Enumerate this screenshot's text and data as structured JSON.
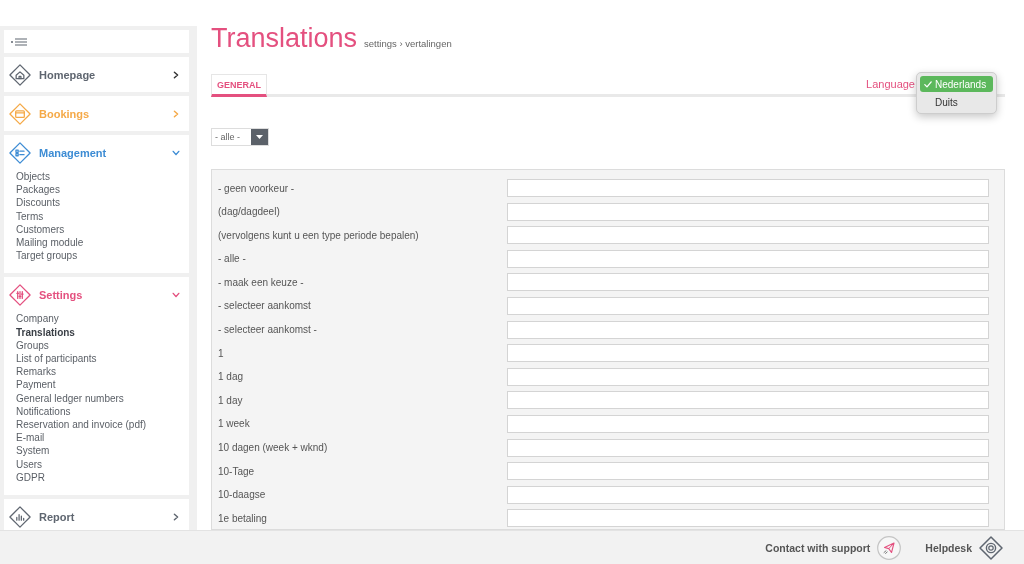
{
  "sidebar": {
    "sections": [
      {
        "label": "Homepage",
        "color": "#5f6670",
        "expanded": false
      },
      {
        "label": "Bookings",
        "color": "#f5a947",
        "expanded": false
      },
      {
        "label": "Management",
        "color": "#3d8cd4",
        "expanded": true,
        "items": [
          {
            "label": "Objects",
            "selected": false
          },
          {
            "label": "Packages",
            "selected": false
          },
          {
            "label": "Discounts",
            "selected": false
          },
          {
            "label": "Terms",
            "selected": false
          },
          {
            "label": "Customers",
            "selected": false
          },
          {
            "label": "Mailing module",
            "selected": false
          },
          {
            "label": "Target groups",
            "selected": false
          }
        ]
      },
      {
        "label": "Settings",
        "color": "#e4507f",
        "expanded": true,
        "items": [
          {
            "label": "Company",
            "selected": false
          },
          {
            "label": "Translations",
            "selected": true
          },
          {
            "label": "Groups",
            "selected": false
          },
          {
            "label": "List of participants",
            "selected": false
          },
          {
            "label": "Remarks",
            "selected": false
          },
          {
            "label": "Payment",
            "selected": false
          },
          {
            "label": "General ledger numbers",
            "selected": false
          },
          {
            "label": "Notifications",
            "selected": false
          },
          {
            "label": "Reservation and invoice (pdf)",
            "selected": false
          },
          {
            "label": "E-mail",
            "selected": false
          },
          {
            "label": "System",
            "selected": false
          },
          {
            "label": "Users",
            "selected": false
          },
          {
            "label": "GDPR",
            "selected": false
          }
        ]
      },
      {
        "label": "Report",
        "color": "#5f6670",
        "expanded": false
      }
    ]
  },
  "page": {
    "title": "Translations",
    "breadcrumb": "settings › vertalingen"
  },
  "tabs": [
    {
      "label": "GENERAL",
      "selected": true
    }
  ],
  "language": {
    "label": "Language",
    "options": [
      {
        "label": "Nederlands",
        "selected": true
      },
      {
        "label": "Duits",
        "selected": false
      }
    ]
  },
  "filter": {
    "value": "- alle -"
  },
  "translations": {
    "rows": [
      {
        "term": "- geen voorkeur -"
      },
      {
        "term": "(dag/dagdeel)"
      },
      {
        "term": "(vervolgens kunt u een type periode bepalen)"
      },
      {
        "term": "- alle -"
      },
      {
        "term": "- maak een keuze -"
      },
      {
        "term": "- selecteer aankomst"
      },
      {
        "term": "- selecteer aankomst -"
      },
      {
        "term": "1"
      },
      {
        "term": "1 dag"
      },
      {
        "term": "1 day"
      },
      {
        "term": "1 week"
      },
      {
        "term": "10 dagen (week + wknd)"
      },
      {
        "term": "10-Tage"
      },
      {
        "term": "10-daagse"
      },
      {
        "term": "1e betaling"
      }
    ]
  },
  "footer": {
    "support": "Contact with support",
    "helpdesk": "Helpdesk"
  }
}
